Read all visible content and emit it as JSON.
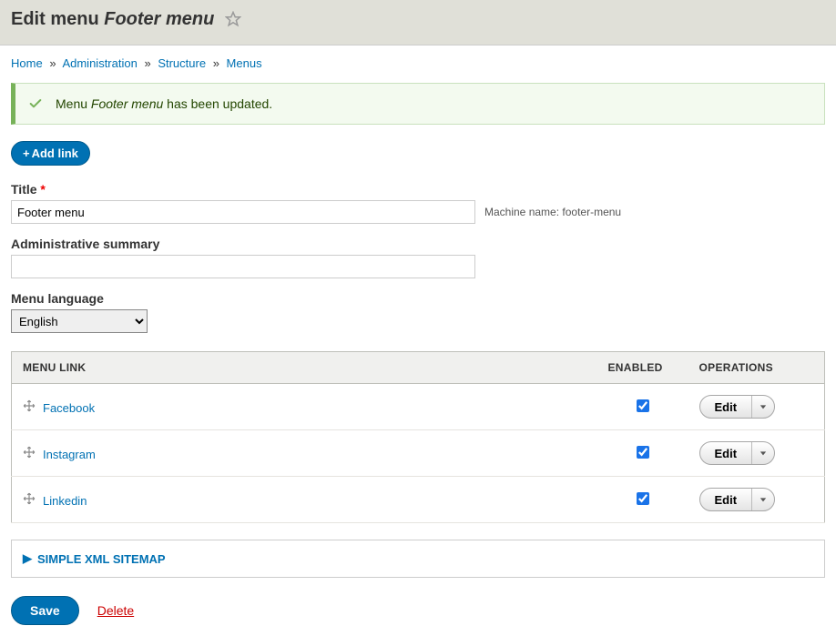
{
  "header": {
    "title_prefix": "Edit menu ",
    "title_italic": "Footer menu"
  },
  "breadcrumb": {
    "items": [
      "Home",
      "Administration",
      "Structure",
      "Menus"
    ]
  },
  "status": {
    "prefix": "Menu ",
    "italic": "Footer menu",
    "suffix": " has been updated."
  },
  "add_link_label": "Add link",
  "form": {
    "title_label": "Title",
    "title_value": "Footer menu",
    "machine_name_label": "Machine name: ",
    "machine_name_value": "footer-menu",
    "summary_label": "Administrative summary",
    "summary_value": "",
    "language_label": "Menu language",
    "language_value": "English"
  },
  "table": {
    "headers": {
      "link": "Menu Link",
      "enabled": "Enabled",
      "operations": "Operations"
    },
    "rows": [
      {
        "label": "Facebook",
        "enabled": true
      },
      {
        "label": "Instagram",
        "enabled": true
      },
      {
        "label": "Linkedin",
        "enabled": true
      }
    ],
    "edit_label": "Edit"
  },
  "fieldset": {
    "label": "Simple XML Sitemap"
  },
  "actions": {
    "save": "Save",
    "delete": "Delete"
  }
}
